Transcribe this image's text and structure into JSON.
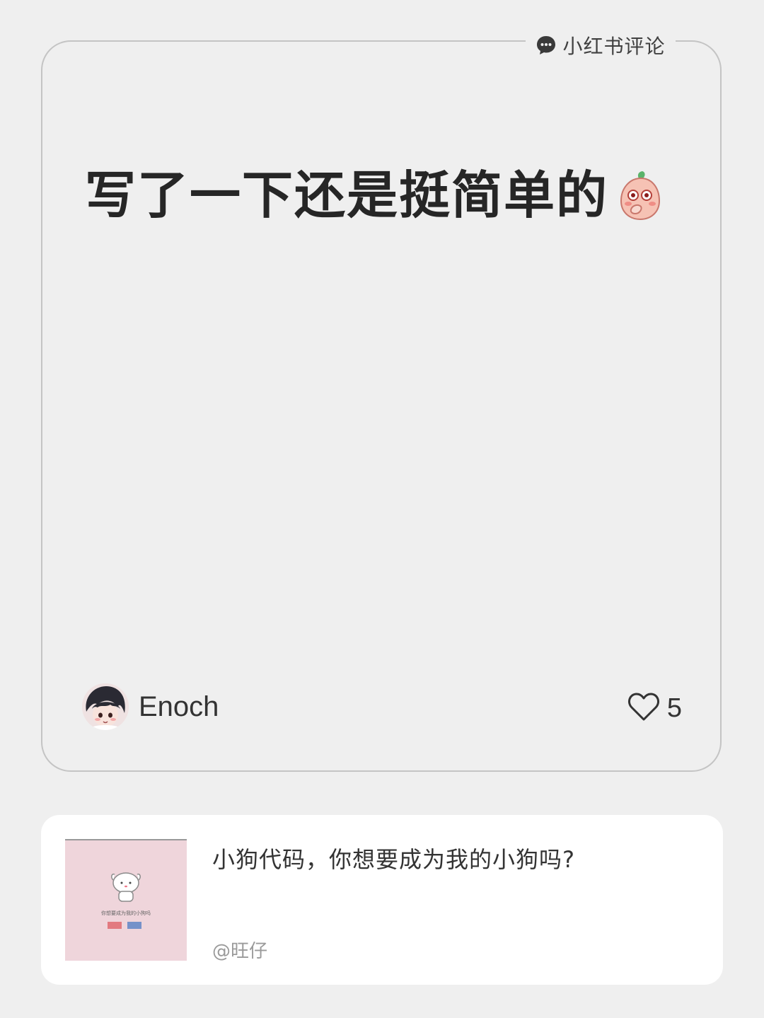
{
  "source_tag": {
    "icon": "chat-bubble-icon",
    "label": "小红书评论"
  },
  "comment": {
    "text": "写了一下还是挺简单的",
    "emoji": "peach-blush-emoji",
    "author": "Enoch",
    "likes": "5",
    "like_icon": "heart-outline-icon"
  },
  "post": {
    "thumbnail": "pink-post-thumbnail",
    "thumbnail_caption": "你想要成为我的小狗吗",
    "title": "小狗代码，你想要成为我的小狗吗?",
    "author": "@旺仔"
  },
  "colors": {
    "background": "#efefef",
    "card_border": "#c4c4c4",
    "text_dark": "#262626",
    "text_muted": "#9a9a9a",
    "thumb_bg": "#efd5db"
  }
}
